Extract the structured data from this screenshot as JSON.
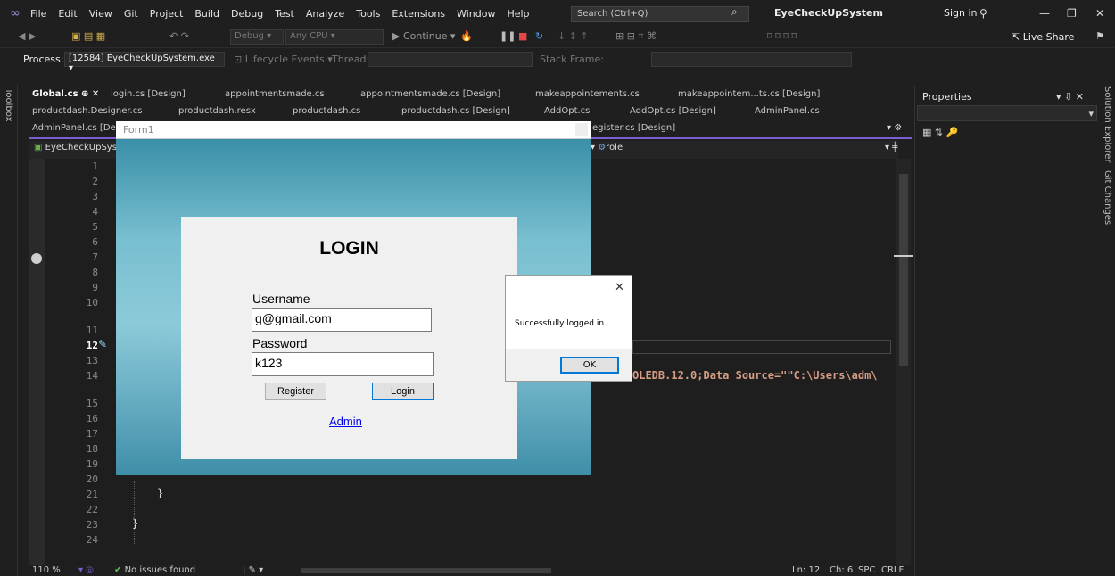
{
  "menubar": {
    "items": [
      "File",
      "Edit",
      "View",
      "Git",
      "Project",
      "Build",
      "Debug",
      "Test",
      "Analyze",
      "Tools",
      "Extensions",
      "Window",
      "Help"
    ],
    "search_placeholder": "Search (Ctrl+Q)",
    "solution_name": "EyeCheckUpSystem",
    "sign_in": "Sign in"
  },
  "toolbar": {
    "config": "Debug",
    "platform": "Any CPU",
    "continue": "Continue",
    "live_share": "Live Share",
    "process_label": "Process:",
    "process_value": "[12584] EyeCheckUpSystem.exe",
    "lifecycle": "Lifecycle Events",
    "thread_label": "Thread:",
    "stack_frame_label": "Stack Frame:"
  },
  "tabs": {
    "row1": [
      "Global.cs",
      "login.cs [Design]",
      "appointmentsmade.cs",
      "appointmentsmade.cs [Design]",
      "makeappointements.cs",
      "makeappointem...ts.cs [Design]"
    ],
    "row2": [
      "productdash.Designer.cs",
      "productdash.resx",
      "productdash.cs",
      "productdash.cs [Design]",
      "AddOpt.cs",
      "AddOpt.cs [Design]",
      "AdminPanel.cs"
    ],
    "row3": [
      "AdminPanel.cs [De",
      "egister.cs [Design]"
    ]
  },
  "navbar": {
    "left": "EyeCheckUpSyst",
    "member": "role"
  },
  "editor": {
    "line_numbers": [
      "1",
      "2",
      "3",
      "4",
      "5",
      "6",
      "7",
      "8",
      "9",
      "10",
      "11",
      "12",
      "13",
      "14",
      "15",
      "16",
      "17",
      "18",
      "19",
      "20",
      "21",
      "22",
      "23",
      "24"
    ],
    "brace21": "}",
    "brace23": "}",
    "code_line14": "OLEDB.12.0;Data Source=\"\"C:\\Users\\adm\\"
  },
  "status": {
    "zoom": "110 %",
    "issues": "No issues found",
    "ln": "Ln: 12",
    "ch": "Ch: 6",
    "spc": "SPC",
    "crlf": "CRLF"
  },
  "side": {
    "toolbox": "Toolbox",
    "solution_explorer": "Solution Explorer",
    "git_changes": "Git Changes",
    "properties": "Properties"
  },
  "form1": {
    "title": "Form1",
    "login_title": "LOGIN",
    "username_label": "Username",
    "username_value": "g@gmail.com",
    "password_label": "Password",
    "password_value": "k123",
    "register_button": "Register",
    "login_button": "Login",
    "admin_link": "Admin"
  },
  "msgbox": {
    "message": "Successfully logged in",
    "ok_button": "OK",
    "close": "✕"
  }
}
